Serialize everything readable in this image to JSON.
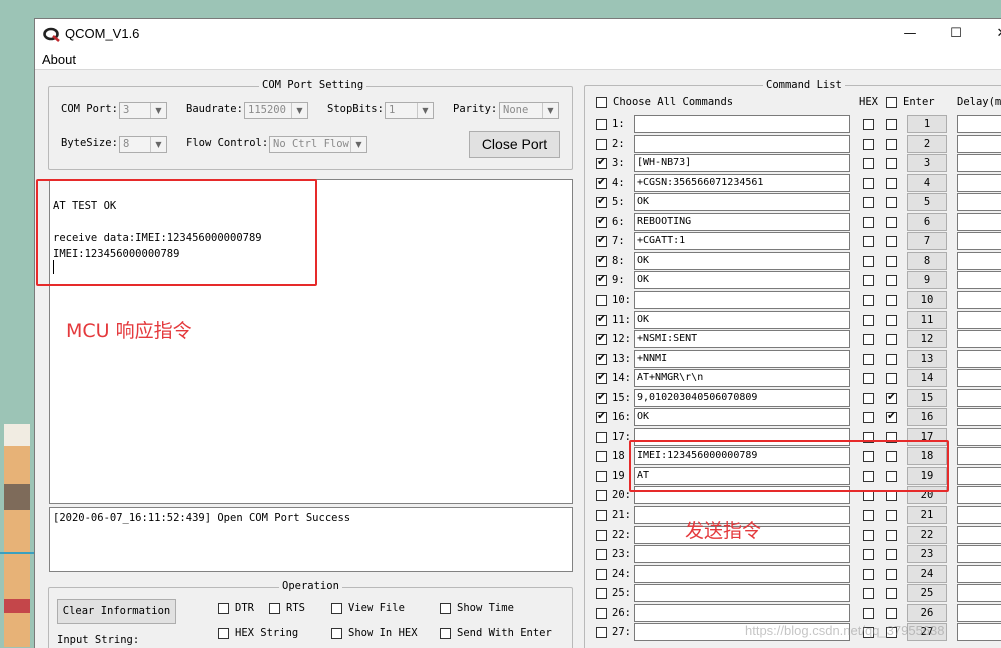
{
  "window": {
    "title": "QCOM_V1.6",
    "minimize_glyph": "—",
    "maximize_glyph": "☐",
    "close_glyph": "✕",
    "app_icon": "qcom-logo-icon"
  },
  "menu": {
    "about": "About"
  },
  "com_setting": {
    "group_label": "COM Port Setting",
    "com_port_label": "COM Port:",
    "com_port_value": "3",
    "baudrate_label": "Baudrate:",
    "baudrate_value": "115200",
    "stopbits_label": "StopBits:",
    "stopbits_value": "1",
    "parity_label": "Parity:",
    "parity_value": "None",
    "bytesize_label": "ByteSize:",
    "bytesize_value": "8",
    "flow_label": "Flow Control:",
    "flow_value": "No Ctrl Flow",
    "close_port_button": "Close Port"
  },
  "receive": {
    "lines": [
      "AT TEST OK",
      "",
      "receive data:IMEI:123456000000789",
      "IMEI:123456000000789"
    ]
  },
  "annotations": {
    "mcu_response": "MCU 响应指令",
    "send_command": "发送指令",
    "color": "#e4393c"
  },
  "log": {
    "text": "[2020-06-07_16:11:52:439] Open COM Port Success"
  },
  "operation": {
    "group_label": "Operation",
    "clear_button": "Clear Information",
    "input_label": "Input String:",
    "options": [
      {
        "label": "DTR",
        "checked": false
      },
      {
        "label": "RTS",
        "checked": false
      },
      {
        "label": "View File",
        "checked": false
      },
      {
        "label": "Show Time",
        "checked": false
      },
      {
        "label": "HEX String",
        "checked": false
      },
      {
        "label": "Show In HEX",
        "checked": false
      },
      {
        "label": "Send With Enter",
        "checked": false
      }
    ]
  },
  "command_list": {
    "group_label": "Command List",
    "choose_all_label": "Choose All Commands",
    "hex_header": "HEX",
    "enter_header": "Enter",
    "delay_header": "Delay(mS)",
    "rows": [
      {
        "no": "1:",
        "checked": false,
        "cmd": "",
        "hex": false,
        "enter": false,
        "btn": "1"
      },
      {
        "no": "2:",
        "checked": false,
        "cmd": "",
        "hex": false,
        "enter": false,
        "btn": "2"
      },
      {
        "no": "3:",
        "checked": true,
        "cmd": "[WH-NB73]",
        "hex": false,
        "enter": false,
        "btn": "3"
      },
      {
        "no": "4:",
        "checked": true,
        "cmd": "+CGSN:356566071234561",
        "hex": false,
        "enter": false,
        "btn": "4"
      },
      {
        "no": "5:",
        "checked": true,
        "cmd": "OK",
        "hex": false,
        "enter": false,
        "btn": "5"
      },
      {
        "no": "6:",
        "checked": true,
        "cmd": "REBOOTING",
        "hex": false,
        "enter": false,
        "btn": "6"
      },
      {
        "no": "7:",
        "checked": true,
        "cmd": "+CGATT:1",
        "hex": false,
        "enter": false,
        "btn": "7"
      },
      {
        "no": "8:",
        "checked": true,
        "cmd": "OK",
        "hex": false,
        "enter": false,
        "btn": "8"
      },
      {
        "no": "9:",
        "checked": true,
        "cmd": "OK",
        "hex": false,
        "enter": false,
        "btn": "9"
      },
      {
        "no": "10:",
        "checked": false,
        "cmd": "",
        "hex": false,
        "enter": false,
        "btn": "10"
      },
      {
        "no": "11:",
        "checked": true,
        "cmd": "OK",
        "hex": false,
        "enter": false,
        "btn": "11"
      },
      {
        "no": "12:",
        "checked": true,
        "cmd": "+NSMI:SENT",
        "hex": false,
        "enter": false,
        "btn": "12"
      },
      {
        "no": "13:",
        "checked": true,
        "cmd": "+NNMI",
        "hex": false,
        "enter": false,
        "btn": "13"
      },
      {
        "no": "14:",
        "checked": true,
        "cmd": "AT+NMGR\\r\\n",
        "hex": false,
        "enter": false,
        "btn": "14"
      },
      {
        "no": "15:",
        "checked": true,
        "cmd": "9,010203040506070809",
        "hex": false,
        "enter": true,
        "btn": "15"
      },
      {
        "no": "16:",
        "checked": true,
        "cmd": "OK",
        "hex": false,
        "enter": true,
        "btn": "16"
      },
      {
        "no": "17:",
        "checked": false,
        "cmd": "",
        "hex": false,
        "enter": false,
        "btn": "17"
      },
      {
        "no": "18",
        "checked": false,
        "cmd": "IMEI:123456000000789",
        "hex": false,
        "enter": false,
        "btn": "18"
      },
      {
        "no": "19",
        "checked": false,
        "cmd": "AT",
        "hex": false,
        "enter": false,
        "btn": "19"
      },
      {
        "no": "20:",
        "checked": false,
        "cmd": "",
        "hex": false,
        "enter": false,
        "btn": "20"
      },
      {
        "no": "21:",
        "checked": false,
        "cmd": "",
        "hex": false,
        "enter": false,
        "btn": "21"
      },
      {
        "no": "22:",
        "checked": false,
        "cmd": "",
        "hex": false,
        "enter": false,
        "btn": "22"
      },
      {
        "no": "23:",
        "checked": false,
        "cmd": "",
        "hex": false,
        "enter": false,
        "btn": "23"
      },
      {
        "no": "24:",
        "checked": false,
        "cmd": "",
        "hex": false,
        "enter": false,
        "btn": "24"
      },
      {
        "no": "25:",
        "checked": false,
        "cmd": "",
        "hex": false,
        "enter": false,
        "btn": "25"
      },
      {
        "no": "26:",
        "checked": false,
        "cmd": "",
        "hex": false,
        "enter": false,
        "btn": "26"
      },
      {
        "no": "27:",
        "checked": false,
        "cmd": "",
        "hex": false,
        "enter": false,
        "btn": "27"
      }
    ]
  },
  "watermark": "https://blog.csdn.net/qq_37955638"
}
